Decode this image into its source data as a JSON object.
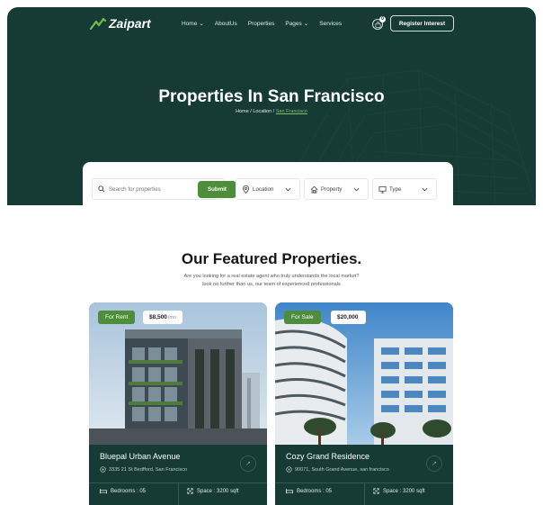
{
  "nav": {
    "logo_text": "Zaipart",
    "menu": [
      {
        "label": "Home",
        "dropdown": true
      },
      {
        "label": "AboutUs",
        "dropdown": false
      },
      {
        "label": "Properties",
        "dropdown": false
      },
      {
        "label": "Pages",
        "dropdown": true
      },
      {
        "label": "Services",
        "dropdown": false
      }
    ],
    "cart_count": "0",
    "register_label": "Register Interest"
  },
  "hero": {
    "title": "Properties In San Francisco",
    "breadcrumb": {
      "home": "Home",
      "sep": " / ",
      "location": "Location",
      "current": "San Francisco"
    }
  },
  "search": {
    "placeholder": "Search for properties",
    "submit_label": "Submit",
    "location_label": "Location",
    "property_label": "Property",
    "type_label": "Type"
  },
  "featured": {
    "title": "Our Featured Properties.",
    "subtitle_line1": "Are you looking for a real estate agent who truly understands the local market?",
    "subtitle_line2": "look no further than us, our team of experienced professionals"
  },
  "cards": [
    {
      "tag": "For Rent",
      "price": "$8,500",
      "per": "/mo",
      "title": "Bluepal Urban Avenue",
      "address": "3335 21 St Bedfford, San Francisco",
      "bedrooms": "Bedrooms : 05",
      "space": "Space : 3200 sqft"
    },
    {
      "tag": "For Sale",
      "price": "$20,000",
      "per": "",
      "title": "Cozy Grand Residence",
      "address": "90071, South Grand Avenue, san francisco",
      "bedrooms": "Bedrooms : 05",
      "space": "Space : 3200 sqft"
    }
  ],
  "colors": {
    "brand_dark": "#163b35",
    "accent_green": "#4e8d3b"
  }
}
